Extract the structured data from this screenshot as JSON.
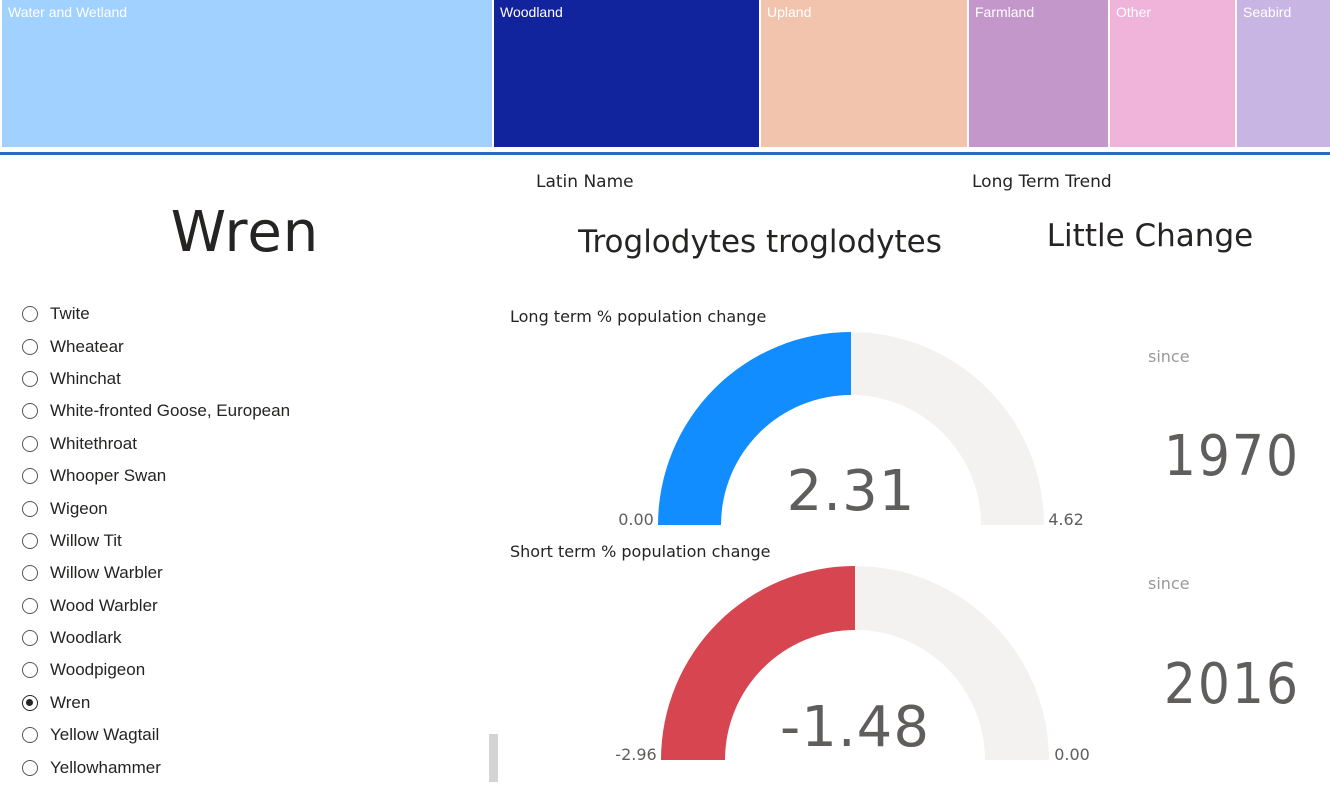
{
  "treemap": {
    "tiles": [
      {
        "label": "Water and Wetland",
        "color": "#a0d1ff"
      },
      {
        "label": "Woodland",
        "color": "#12239e"
      },
      {
        "label": "Upland",
        "color": "#f2c4ae"
      },
      {
        "label": "Farmland",
        "color": "#c397c9"
      },
      {
        "label": "Other",
        "color": "#f0b3da"
      },
      {
        "label": "Seabird",
        "color": "#c9b5e4"
      }
    ]
  },
  "headers": {
    "latin_name": "Latin Name",
    "long_term_trend": "Long Term Trend"
  },
  "selected": {
    "bird": "Wren",
    "latin": "Troglodytes troglodytes",
    "trend": "Little Change"
  },
  "slicer": {
    "items": [
      {
        "label": "Twite",
        "checked": false
      },
      {
        "label": "Wheatear",
        "checked": false
      },
      {
        "label": "Whinchat",
        "checked": false
      },
      {
        "label": "White-fronted Goose, European",
        "checked": false
      },
      {
        "label": "Whitethroat",
        "checked": false
      },
      {
        "label": "Whooper Swan",
        "checked": false
      },
      {
        "label": "Wigeon",
        "checked": false
      },
      {
        "label": "Willow Tit",
        "checked": false
      },
      {
        "label": "Willow Warbler",
        "checked": false
      },
      {
        "label": "Wood Warbler",
        "checked": false
      },
      {
        "label": "Woodlark",
        "checked": false
      },
      {
        "label": "Woodpigeon",
        "checked": false
      },
      {
        "label": "Wren",
        "checked": true
      },
      {
        "label": "Yellow Wagtail",
        "checked": false
      },
      {
        "label": "Yellowhammer",
        "checked": false
      }
    ]
  },
  "gauges": [
    {
      "title": "Long term % population change",
      "value": 2.31,
      "value_label": "2.31",
      "min": 0,
      "min_label": "0.00",
      "max": 4.62,
      "max_label": "4.62",
      "color": "#118dff",
      "since_label": "since",
      "year": "1970"
    },
    {
      "title": "Short term % population change",
      "value": -1.48,
      "value_label": "-1.48",
      "min": -2.96,
      "min_label": "-2.96",
      "max": 0,
      "max_label": "0.00",
      "color": "#d64550",
      "since_label": "since",
      "year": "2016"
    }
  ]
}
